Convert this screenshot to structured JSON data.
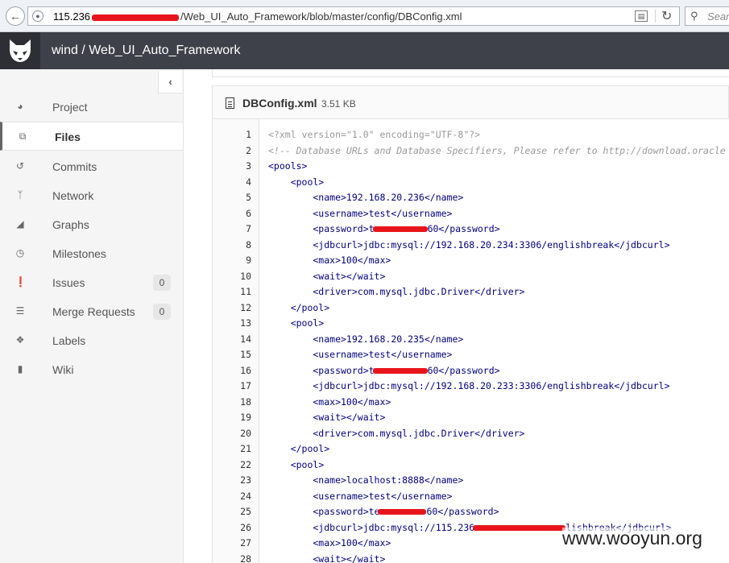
{
  "browser": {
    "url_host": "115.236",
    "url_path": "/Web_UI_Auto_Framework/blob/master/config/DBConfig.xml",
    "search_placeholder": "Sear"
  },
  "header": {
    "project_title": "wind / Web_UI_Auto_Framework"
  },
  "sidebar": {
    "items": [
      {
        "label": "Project",
        "icon": "dashboard-icon"
      },
      {
        "label": "Files",
        "icon": "files-icon",
        "active": true
      },
      {
        "label": "Commits",
        "icon": "history-icon"
      },
      {
        "label": "Network",
        "icon": "code-fork-icon"
      },
      {
        "label": "Graphs",
        "icon": "area-chart-icon"
      },
      {
        "label": "Milestones",
        "icon": "clock-icon"
      },
      {
        "label": "Issues",
        "icon": "exclamation-circle-icon",
        "count": "0"
      },
      {
        "label": "Merge Requests",
        "icon": "tasks-icon",
        "count": "0"
      },
      {
        "label": "Labels",
        "icon": "tags-icon"
      },
      {
        "label": "Wiki",
        "icon": "book-icon"
      }
    ]
  },
  "file": {
    "name": "DBConfig.xml",
    "size": "3.51 KB"
  },
  "code": {
    "line_numbers": [
      "1",
      "2",
      "3",
      "4",
      "5",
      "6",
      "7",
      "8",
      "9",
      "10",
      "11",
      "12",
      "13",
      "14",
      "15",
      "16",
      "17",
      "18",
      "19",
      "20",
      "21",
      "22",
      "23",
      "24",
      "25",
      "26",
      "27",
      "28"
    ],
    "l1": "<?xml version=\"1.0\" encoding=\"UTF-8\"?>",
    "l2": "<!-- Database URLs and Database Specifiers, Please refer to http://download.oracle",
    "l3": "<pools>",
    "l4": "    <pool>",
    "l5": "        <name>192.168.20.236</name>",
    "l6": "        <username>test</username>",
    "l7a": "        <password>t",
    "l7b": "60</password>",
    "l8": "        <jdbcurl>jdbc:mysql://192.168.20.234:3306/englishbreak</jdbcurl>",
    "l9": "        <max>100</max>",
    "l10": "        <wait></wait>",
    "l11": "        <driver>com.mysql.jdbc.Driver</driver>",
    "l12": "    </pool>",
    "l13": "    <pool>",
    "l14": "        <name>192.168.20.235</name>",
    "l15": "        <username>test</username>",
    "l16a": "        <password>t",
    "l16b": "60</password>",
    "l17": "        <jdbcurl>jdbc:mysql://192.168.20.233:3306/englishbreak</jdbcurl>",
    "l18": "        <max>100</max>",
    "l19": "        <wait></wait>",
    "l20": "        <driver>com.mysql.jdbc.Driver</driver>",
    "l21": "    </pool>",
    "l22": "    <pool>",
    "l23": "        <name>localhost:8888</name>",
    "l24": "        <username>test</username>",
    "l25a": "        <password>te",
    "l25b": "60</password>",
    "l26a": "        <jdbcurl>jdbc:mysql://115.236",
    "l26b": "lishbreak</jdbcurl>",
    "l27": "        <max>100</max>",
    "l28": "        <wait></wait>"
  },
  "watermark": "www.wooyun.org"
}
